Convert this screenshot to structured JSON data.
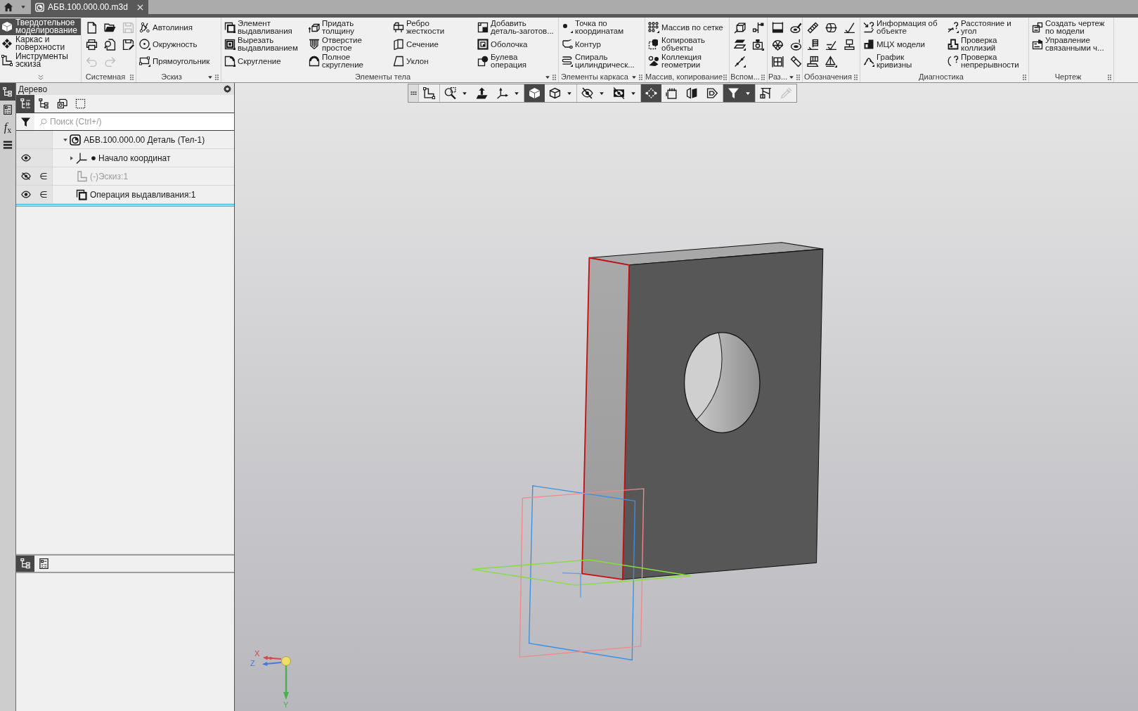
{
  "title_bar": {
    "tabs": [
      {
        "label": "АБВ.100.000.00.m3d",
        "selected": true
      }
    ]
  },
  "ribbon": {
    "modes": [
      {
        "kind": "solid",
        "label": "Твердотельное\nмоделирование",
        "selected": true
      },
      {
        "kind": "surface",
        "label": "Каркас и\nповерхности",
        "selected": false
      },
      {
        "kind": "sketch_tools",
        "label": "Инструменты\nэскиза",
        "selected": false
      }
    ],
    "groups": [
      {
        "label": "Системная",
        "kind": "icons",
        "menu": false,
        "buttons": [
          {
            "kind": "new",
            "disabled": false
          },
          {
            "kind": "open",
            "disabled": false
          },
          {
            "kind": "save",
            "disabled": true
          },
          {
            "kind": "print",
            "disabled": false
          },
          {
            "kind": "preview",
            "disabled": false
          },
          {
            "kind": "save_as",
            "disabled": false
          },
          {
            "kind": "undo",
            "disabled": true
          },
          {
            "kind": "redo",
            "disabled": true
          }
        ]
      },
      {
        "label": "Эскиз",
        "kind": "labeled",
        "menu": true,
        "buttons": [
          {
            "kind": "autoline",
            "label": "Автолиния"
          },
          {
            "kind": "circle",
            "label": "Окружность"
          },
          {
            "kind": "rectangle",
            "label": "Прямоугольник"
          }
        ]
      },
      {
        "label": "Элементы тела",
        "kind": "labeled",
        "menu": true,
        "buttons": [
          {
            "kind": "extrude",
            "label": "Элемент\nвыдавливания"
          },
          {
            "kind": "cut_extrude",
            "label": "Вырезать\nвыдавливанием"
          },
          {
            "kind": "fillet",
            "label": "Скругление"
          },
          {
            "kind": "thicken",
            "label": "Придать\nтолщину"
          },
          {
            "kind": "hole",
            "label": "Отверстие\nпростое"
          },
          {
            "kind": "full_round",
            "label": "Полное\nскругление"
          },
          {
            "kind": "rib",
            "label": "Ребро\nжесткости"
          },
          {
            "kind": "section",
            "label": "Сечение"
          },
          {
            "kind": "draft",
            "label": "Уклон"
          },
          {
            "kind": "add_part",
            "label": "Добавить\nдеталь-заготов..."
          },
          {
            "kind": "shell",
            "label": "Оболочка"
          },
          {
            "kind": "boolean",
            "label": "Булева\nоперация"
          }
        ]
      },
      {
        "label": "Элементы каркаса",
        "kind": "labeled",
        "menu": true,
        "buttons": [
          {
            "kind": "point",
            "label": "Точка по\nкоординатам"
          },
          {
            "kind": "contour",
            "label": "Контур"
          },
          {
            "kind": "spiral",
            "label": "Спираль\nцилиндрическ..."
          }
        ]
      },
      {
        "label": "Массив, копирование",
        "kind": "labeled",
        "menu": false,
        "buttons": [
          {
            "kind": "grid_array",
            "label": "Массив по сетке"
          },
          {
            "kind": "copy",
            "label": "Копировать\nобъекты"
          },
          {
            "kind": "collection",
            "label": "Коллекция\nгеометрии"
          }
        ]
      },
      {
        "label": "Вспом...",
        "kind": "icons",
        "menu": false,
        "buttons": [
          {
            "kind": "plane_cube"
          },
          {
            "kind": "branch"
          },
          {
            "kind": "planes"
          },
          {
            "kind": "camera"
          },
          {
            "kind": "dotted_line"
          }
        ]
      },
      {
        "label": "Раз...",
        "kind": "icons",
        "menu": true,
        "buttons": [
          {
            "kind": "frame"
          },
          {
            "kind": "disk_pen"
          },
          {
            "kind": "mesh_dome"
          },
          {
            "kind": "disk"
          },
          {
            "kind": "grid_box"
          },
          {
            "kind": "diagonal_box"
          }
        ]
      },
      {
        "label": "Обозначения",
        "kind": "icons",
        "menu": false,
        "buttons": [
          {
            "kind": "rod"
          },
          {
            "kind": "cylinder"
          },
          {
            "kind": "check_line"
          },
          {
            "kind": "comb_mark"
          },
          {
            "kind": "slash_base"
          },
          {
            "kind": "stamp"
          },
          {
            "kind": "flag_base"
          },
          {
            "kind": "triangle_mark"
          }
        ]
      },
      {
        "label": "Диагностика",
        "kind": "labeled",
        "menu": false,
        "buttons": [
          {
            "kind": "info",
            "label": "Информация об\nобъекте"
          },
          {
            "kind": "mass",
            "label": "МЦХ модели"
          },
          {
            "kind": "curvature",
            "label": "График\nкривизны"
          },
          {
            "kind": "distance",
            "label": "Расстояние и\nугол"
          },
          {
            "kind": "collision",
            "label": "Проверка\nколлизий"
          },
          {
            "kind": "continuity",
            "label": "Проверка\nнепрерывности"
          }
        ]
      },
      {
        "label": "Чертеж",
        "kind": "labeled",
        "menu": false,
        "buttons": [
          {
            "kind": "create_drawing",
            "label": "Создать чертеж\nпо модели"
          },
          {
            "kind": "linked_drawings",
            "label": "Управление\nсвязанными ч..."
          }
        ]
      }
    ]
  },
  "side_strip": [
    {
      "kind": "tree",
      "selected": true
    },
    {
      "kind": "properties",
      "selected": false
    },
    {
      "kind": "variables",
      "label": "*f*$_{x}$",
      "selected": false
    },
    {
      "kind": "layers",
      "selected": false
    }
  ],
  "tree_panel": {
    "title": "Дерево",
    "toolbar": [
      {
        "kind": "numbered_tree",
        "selected": true
      },
      {
        "kind": "tree",
        "selected": false
      },
      {
        "kind": "sheets",
        "selected": false
      },
      {
        "kind": "dashed_frame",
        "selected": false
      }
    ],
    "search": {
      "placeholder": "Поиск (Ctrl+/)"
    },
    "tree": [
      {
        "kind": "part",
        "label": "АБВ.100.000.00 Деталь (Тел-1)",
        "expanded": true,
        "children": [
          {
            "kind": "origin",
            "label": "Начало координат",
            "visible": true,
            "expanded": false
          },
          {
            "kind": "sketch",
            "label": "(-)Эскиз:1",
            "visible": false,
            "symbol": "∈"
          },
          {
            "kind": "extrusion",
            "label": "Операция выдавливания:1",
            "visible": true,
            "symbol": "∈"
          }
        ]
      }
    ],
    "bottom_toolbar": [
      {
        "kind": "tree",
        "selected": true
      },
      {
        "kind": "properties",
        "selected": false
      }
    ]
  },
  "viewport": {
    "view_toolbar": {
      "groups": [
        {
          "buttons": [
            {
              "kind": "orientation",
              "selected": false,
              "menu": false,
              "disabled": false
            }
          ]
        },
        {
          "buttons": [
            {
              "kind": "zoom",
              "selected": false,
              "menu": true,
              "disabled": false
            },
            {
              "kind": "pan",
              "selected": false,
              "menu": false,
              "disabled": false
            },
            {
              "kind": "axes",
              "selected": false,
              "menu": true,
              "disabled": false
            }
          ]
        },
        {
          "buttons": [
            {
              "kind": "shaded",
              "selected": true,
              "menu": false,
              "disabled": false
            },
            {
              "kind": "wireframe",
              "selected": false,
              "menu": true,
              "disabled": false
            }
          ]
        },
        {
          "buttons": [
            {
              "kind": "hide",
              "selected": false,
              "menu": true,
              "disabled": false
            },
            {
              "kind": "show",
              "selected": false,
              "menu": true,
              "disabled": false
            }
          ]
        },
        {
          "buttons": [
            {
              "kind": "path",
              "selected": true,
              "menu": false,
              "disabled": false
            },
            {
              "kind": "notes",
              "selected": false,
              "menu": false,
              "disabled": false
            },
            {
              "kind": "split",
              "selected": false,
              "menu": false,
              "disabled": false
            },
            {
              "kind": "layers3d",
              "selected": false,
              "menu": false,
              "disabled": false
            }
          ]
        },
        {
          "buttons": [
            {
              "kind": "filter",
              "selected": true,
              "menu": true,
              "disabled": false
            }
          ]
        },
        {
          "buttons": [
            {
              "kind": "crane",
              "selected": false,
              "menu": false,
              "disabled": false
            },
            {
              "kind": "pipette",
              "selected": false,
              "menu": false,
              "disabled": true
            }
          ]
        }
      ]
    },
    "axis_labels": {
      "x": "X",
      "z": "Z",
      "y": "Y"
    }
  }
}
